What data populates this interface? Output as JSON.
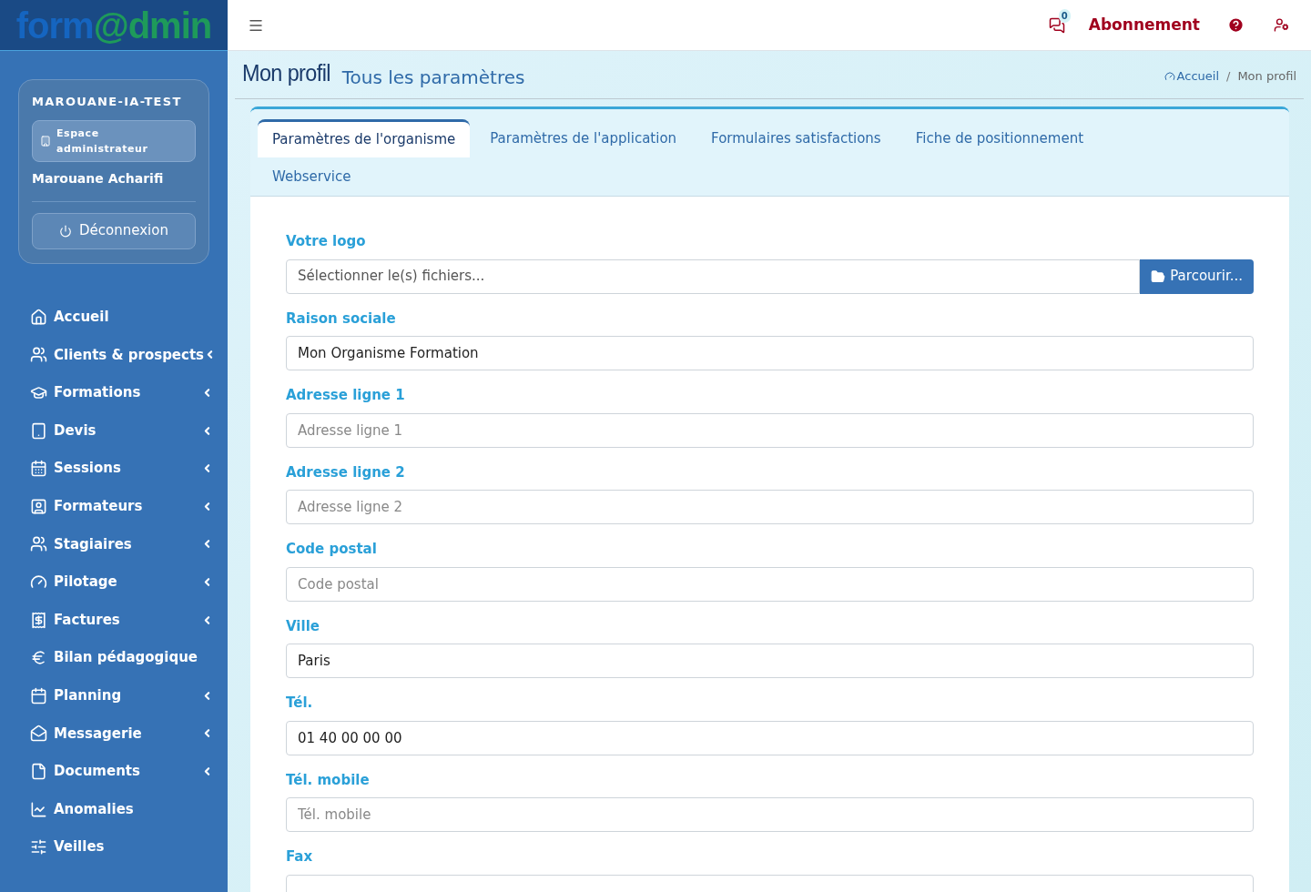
{
  "logo": {
    "first": "form",
    "second": "@dmin"
  },
  "user_card": {
    "org": "MAROUANE-IA-TEST",
    "space": "Espace administrateur",
    "name": "Marouane Acharifi",
    "logout": "Déconnexion"
  },
  "sidebar": {
    "items": [
      {
        "label": "Accueil",
        "submenu": false
      },
      {
        "label": "Clients & prospects",
        "submenu": true
      },
      {
        "label": "Formations",
        "submenu": true
      },
      {
        "label": "Devis",
        "submenu": true
      },
      {
        "label": "Sessions",
        "submenu": true
      },
      {
        "label": "Formateurs",
        "submenu": true
      },
      {
        "label": "Stagiaires",
        "submenu": true
      },
      {
        "label": "Pilotage",
        "submenu": true
      },
      {
        "label": "Factures",
        "submenu": true
      },
      {
        "label": "Bilan pédagogique",
        "submenu": false
      },
      {
        "label": "Planning",
        "submenu": true
      },
      {
        "label": "Messagerie",
        "submenu": true
      },
      {
        "label": "Documents",
        "submenu": true
      },
      {
        "label": "Anomalies",
        "submenu": false
      },
      {
        "label": "Veilles",
        "submenu": false
      }
    ]
  },
  "header": {
    "messages_count": "0",
    "subscription": "Abonnement"
  },
  "page": {
    "title": "Mon profil",
    "subtitle": "Tous les paramètres",
    "breadcrumb": [
      "Accueil",
      "Mon profil"
    ],
    "breadcrumb_separator": "/"
  },
  "tabs": [
    {
      "label": "Paramètres de l'organisme",
      "selected": true
    },
    {
      "label": "Paramètres de l'application",
      "selected": false
    },
    {
      "label": "Formulaires satisfactions",
      "selected": false
    },
    {
      "label": "Fiche de positionnement",
      "selected": false
    },
    {
      "label": "Webservice",
      "selected": false
    }
  ],
  "form": [
    {
      "kind": "file",
      "label": "Votre logo",
      "placeholder": "Sélectionner le(s) fichiers...",
      "button": "Parcourir..."
    },
    {
      "kind": "text",
      "label": "Raison sociale",
      "value": "Mon Organisme Formation"
    },
    {
      "kind": "text",
      "label": "Adresse ligne 1",
      "placeholder": "Adresse ligne 1"
    },
    {
      "kind": "text",
      "label": "Adresse ligne 2",
      "placeholder": "Adresse ligne 2"
    },
    {
      "kind": "text",
      "label": "Code postal",
      "placeholder": "Code postal"
    },
    {
      "kind": "text",
      "label": "Ville",
      "value": "Paris"
    },
    {
      "kind": "text",
      "label": "Tél.",
      "value": "01 40 00 00 00"
    },
    {
      "kind": "text",
      "label": "Tél. mobile",
      "placeholder": "Tél. mobile"
    },
    {
      "kind": "text",
      "label": "Fax"
    }
  ]
}
